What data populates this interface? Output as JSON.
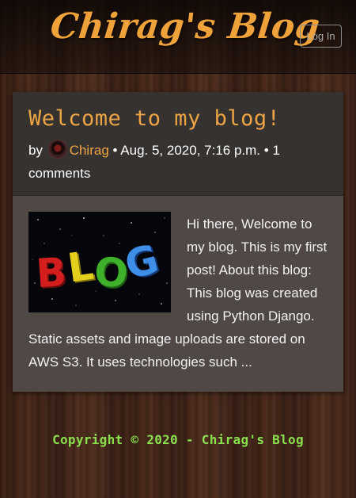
{
  "navbar": {
    "brand": "Chirag's Blog",
    "login_label": "Log In"
  },
  "post": {
    "title": "Welcome to my blog!",
    "by_label": "by",
    "author": "Chirag",
    "separator1": "•",
    "date": "Aug. 5, 2020, 7:16 p.m.",
    "separator2": "•",
    "comments": "1 comments",
    "image_alt": "BLOG",
    "excerpt": "Hi there, Welcome to my blog. This is my first post! About this blog: This blog was created using Python Django. Static assets and image uploads are stored on AWS S3. It uses technologies such ..."
  },
  "footer": {
    "copyright": "Copyright © 2020 - Chirag's Blog"
  },
  "colors": {
    "accent": "#eda445",
    "footer_text": "#8be04e",
    "card_header": "#353230",
    "card_body": "#4f4845"
  }
}
